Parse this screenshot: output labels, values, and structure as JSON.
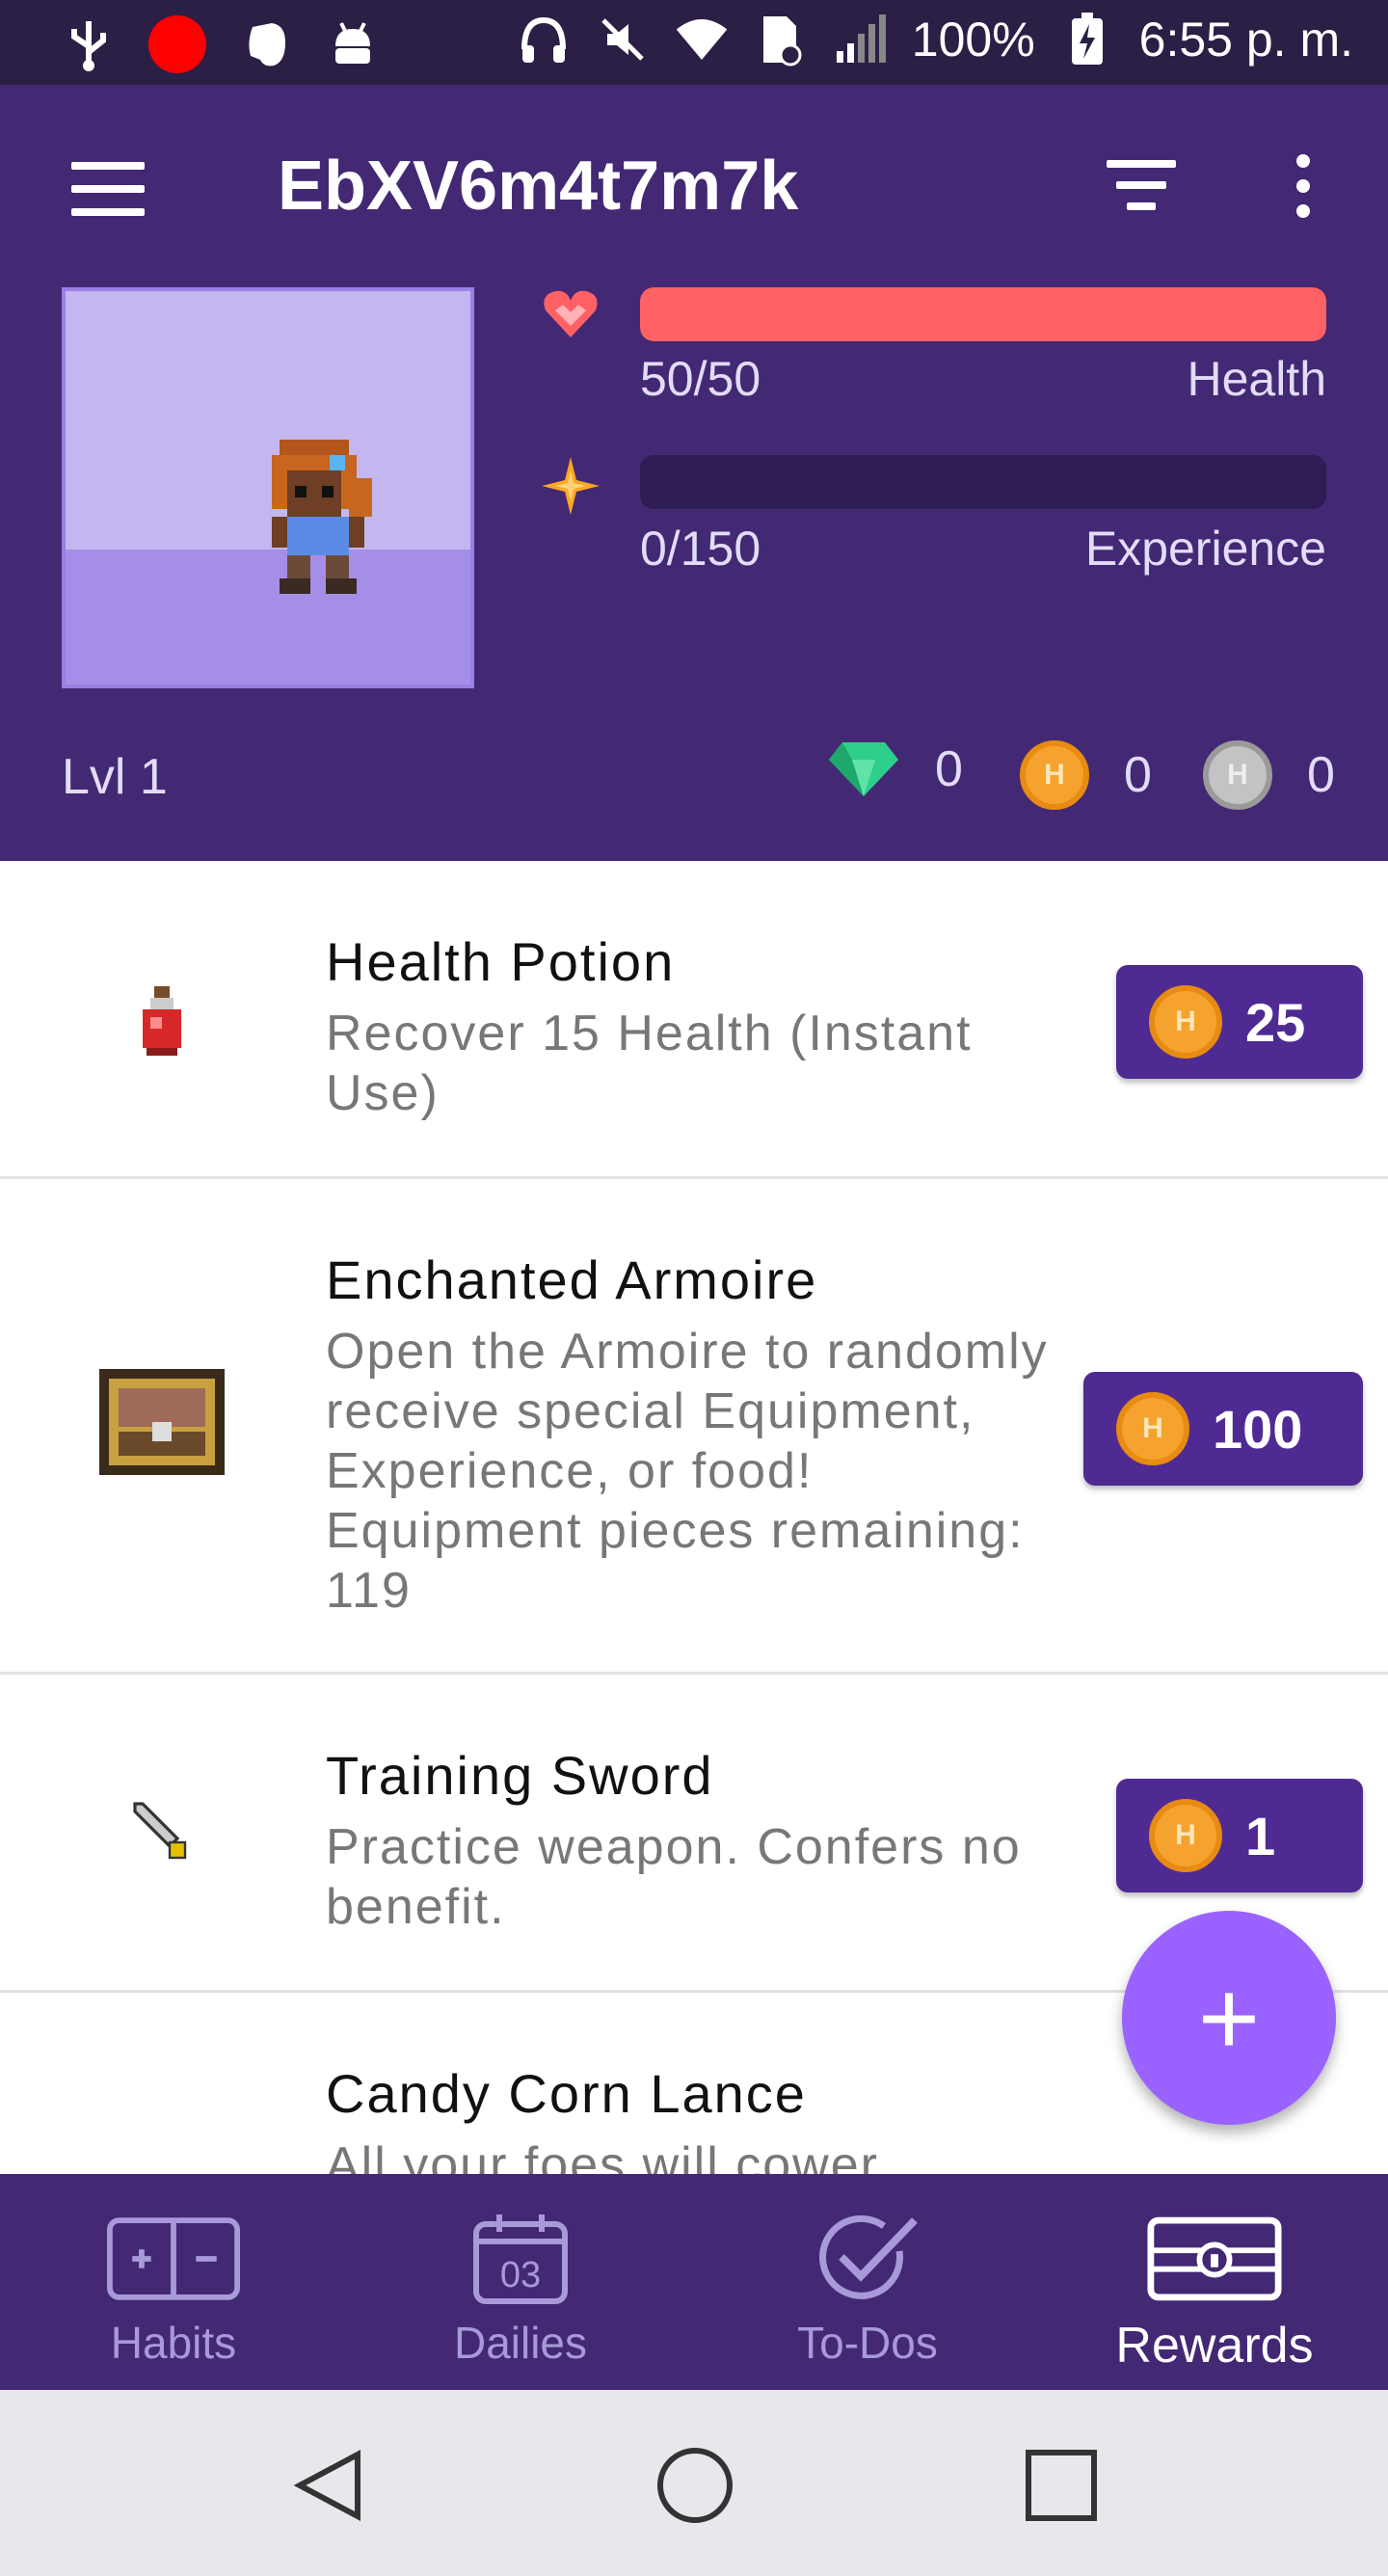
{
  "status_bar": {
    "battery": "100%",
    "time": "6:55 p. m."
  },
  "toolbar": {
    "title": "EbXV6m4t7m7k",
    "icons": [
      "menu-icon",
      "filter-icon",
      "more-icon"
    ]
  },
  "stats": {
    "health": {
      "value": "50/50",
      "label": "Health",
      "fraction": 1.0,
      "color": "#ff6165"
    },
    "experience": {
      "value": "0/150",
      "label": "Experience",
      "fraction": 0.0,
      "color": "#ffa623"
    }
  },
  "profile": {
    "level": "Lvl 1",
    "gems": "0",
    "gold": "0",
    "silver": "0",
    "coin_letter": "H"
  },
  "rewards": [
    {
      "title": "Health Potion",
      "description": "Recover 15 Health (Instant Use)",
      "price": "25",
      "icon": "health-potion-icon"
    },
    {
      "title": "Enchanted Armoire",
      "description": "Open the Armoire to randomly receive special Equipment, Experience, or food! Equipment pieces remaining: 119",
      "price": "100",
      "icon": "armoire-chest-icon"
    },
    {
      "title": "Training Sword",
      "description": "Practice weapon. Confers no benefit.",
      "price": "1",
      "icon": "training-sword-icon"
    },
    {
      "title": "Candy Corn Lance",
      "description": "All your foes will cower",
      "price": "",
      "icon": "lance-icon"
    }
  ],
  "fab": {
    "label": "+"
  },
  "bottom_nav": [
    {
      "label": "Habits",
      "icon": "habits-icon",
      "calendar_number": ""
    },
    {
      "label": "Dailies",
      "icon": "calendar-icon",
      "calendar_number": "03"
    },
    {
      "label": "To-Dos",
      "icon": "checkmark-icon",
      "calendar_number": ""
    },
    {
      "label": "Rewards",
      "icon": "treasure-chest-icon",
      "calendar_number": "",
      "active": true
    }
  ],
  "colors": {
    "header_bg": "#432874",
    "price_button_bg": "#4f2a93",
    "fab_bg": "#9a62ff",
    "nav_inactive": "#a899d9",
    "gem": "#2ecf8a",
    "gold_coin": "#f5a22f",
    "silver_coin": "#c3c3c3"
  }
}
